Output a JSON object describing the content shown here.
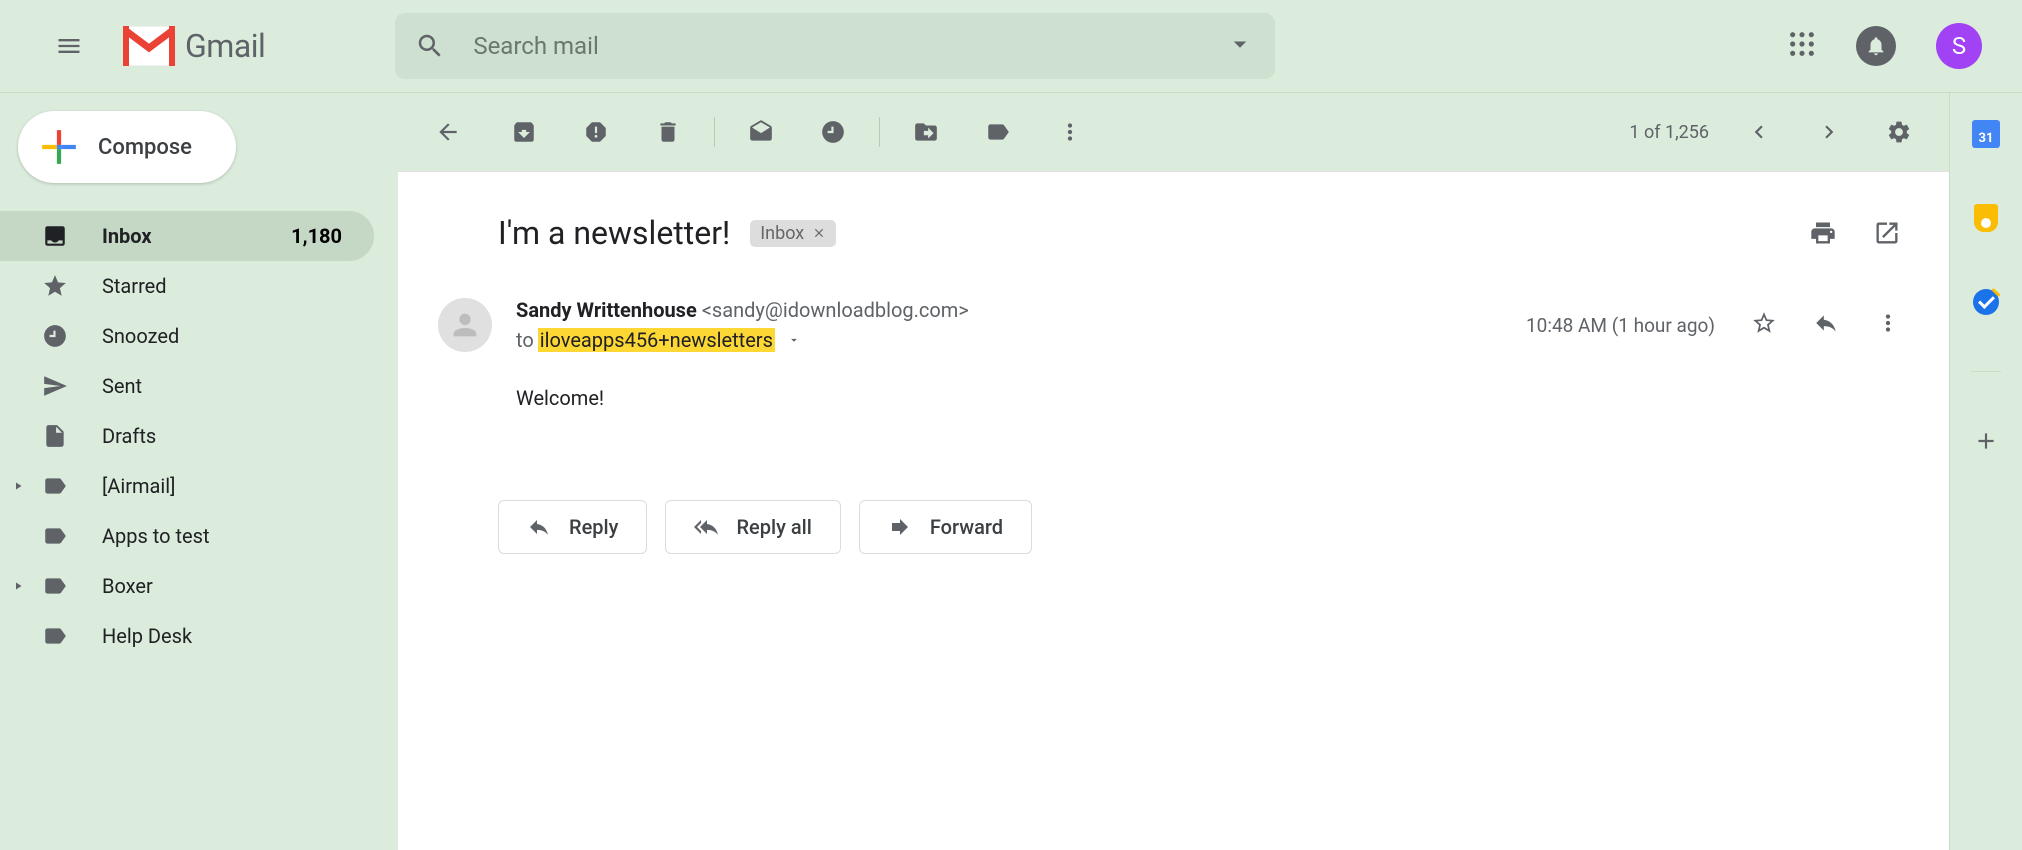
{
  "app": {
    "name": "Gmail"
  },
  "search": {
    "placeholder": "Search mail"
  },
  "avatar": {
    "initial": "S"
  },
  "compose": {
    "label": "Compose"
  },
  "sidebar": {
    "items": [
      {
        "label": "Inbox",
        "count": "1,180"
      },
      {
        "label": "Starred"
      },
      {
        "label": "Snoozed"
      },
      {
        "label": "Sent"
      },
      {
        "label": "Drafts"
      },
      {
        "label": "[Airmail]"
      },
      {
        "label": "Apps to test"
      },
      {
        "label": "Boxer"
      },
      {
        "label": "Help Desk"
      }
    ]
  },
  "toolbar": {
    "counter": "1 of 1,256"
  },
  "message": {
    "subject": "I'm a newsletter!",
    "tag": "Inbox",
    "sender_name": "Sandy Writtenhouse",
    "sender_email": "<sandy@idownloadblog.com>",
    "to_prefix": "to",
    "to_highlight": "iloveapps456+newsletters",
    "time": "10:48 AM (1 hour ago)",
    "body": "Welcome!"
  },
  "actions": {
    "reply": "Reply",
    "reply_all": "Reply all",
    "forward": "Forward"
  },
  "rightRail": {
    "calendar_day": "31"
  }
}
